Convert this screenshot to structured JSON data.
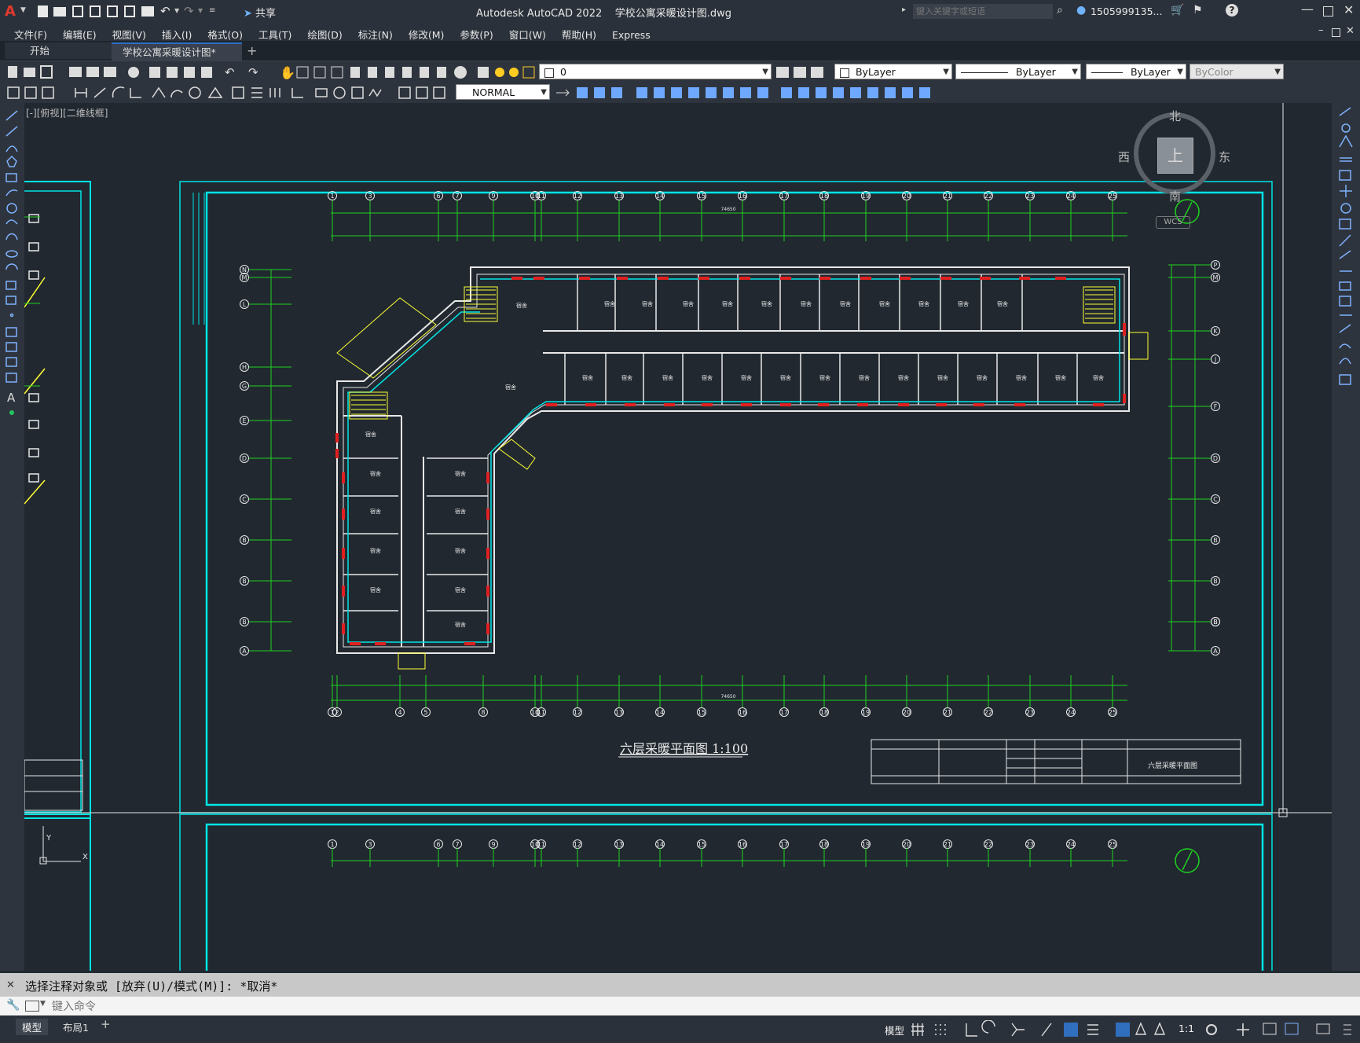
{
  "app": {
    "title": "Autodesk AutoCAD 2022    学校公寓采暖设计图.dwg",
    "search_placeholder": "键入关键字或短语",
    "user": "1505999135...",
    "share_label": "共享"
  },
  "menu": [
    "文件(F)",
    "编辑(E)",
    "视图(V)",
    "插入(I)",
    "格式(O)",
    "工具(T)",
    "绘图(D)",
    "标注(N)",
    "修改(M)",
    "参数(P)",
    "窗口(W)",
    "帮助(H)",
    "Express"
  ],
  "tabs": {
    "start": "开始",
    "doc": "学校公寓采暖设计图*",
    "add": "+"
  },
  "toolbar": {
    "layer_value": "0",
    "color": "ByLayer",
    "linetype": "ByLayer",
    "lineweight": "ByLayer",
    "plotstyle": "ByColor",
    "dimstyle": "NORMAL"
  },
  "viewport": {
    "label": "[-][俯视][二维线框]"
  },
  "viewcube": {
    "north": "北",
    "south": "南",
    "east": "东",
    "west": "西",
    "top": "上",
    "wcs": "WCS"
  },
  "drawing": {
    "title": "六层采暖平面图  1:100",
    "total_dim": "74650",
    "axis_top": [
      "1",
      "3",
      "6",
      "7",
      "9",
      "10",
      "11",
      "12",
      "13",
      "14",
      "15",
      "16",
      "17",
      "18",
      "19",
      "20",
      "21",
      "22",
      "23",
      "24",
      "25"
    ],
    "axis_bottom": [
      "1",
      "2",
      "4",
      "5",
      "8",
      "10",
      "11",
      "12",
      "13",
      "14",
      "15",
      "16",
      "17",
      "18",
      "19",
      "20",
      "21",
      "22",
      "23",
      "24",
      "25"
    ],
    "axis_left": [
      "N",
      "M",
      "L",
      "H",
      "G",
      "E",
      "D",
      "C",
      "B",
      "B",
      "B",
      "A"
    ],
    "axis_right": [
      "P",
      "M",
      "K",
      "J",
      "F",
      "D",
      "C",
      "B",
      "B",
      "B",
      "B",
      "A"
    ],
    "room_label": "宿舍",
    "titleblock_name": "六层采暖平面图"
  },
  "command": {
    "history": "选择注释对象或 [放弃(U)/模式(M)]: *取消*",
    "placeholder": "键入命令"
  },
  "status": {
    "model_tab": "模型",
    "layout_tab": "布局1",
    "add": "+",
    "model_btn": "模型",
    "scale": "1:1"
  },
  "colors": {
    "cyan": "#00e5e5",
    "green": "#1fd21f",
    "yellow": "#ffff33",
    "red": "#e02020",
    "white": "#e8e8e8"
  }
}
